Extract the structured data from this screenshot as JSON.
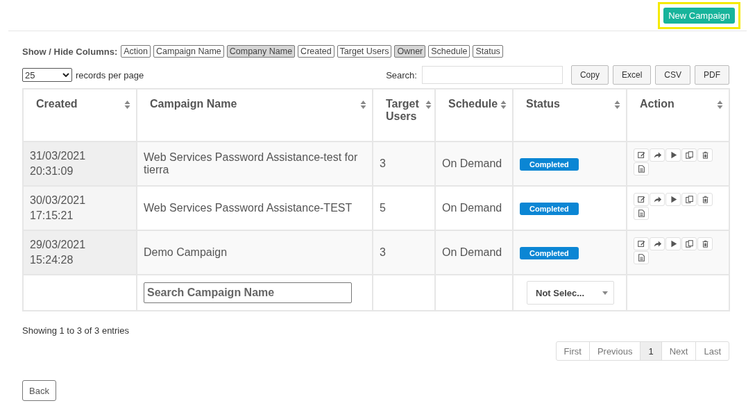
{
  "header": {
    "new_campaign_button": "New Campaign",
    "highlighted": true
  },
  "column_toggles": {
    "label": "Show / Hide Columns:",
    "items": [
      {
        "label": "Action",
        "hidden": false
      },
      {
        "label": "Campaign Name",
        "hidden": false
      },
      {
        "label": "Company Name",
        "hidden": true
      },
      {
        "label": "Created",
        "hidden": false
      },
      {
        "label": "Target Users",
        "hidden": false
      },
      {
        "label": "Owner",
        "hidden": true
      },
      {
        "label": "Schedule",
        "hidden": false
      },
      {
        "label": "Status",
        "hidden": false
      }
    ]
  },
  "page_length": {
    "value": "25",
    "suffix": "records per page"
  },
  "search": {
    "label": "Search:"
  },
  "export_buttons": [
    "Copy",
    "Excel",
    "CSV",
    "PDF"
  ],
  "table": {
    "columns": [
      "Created",
      "Campaign Name",
      "Target Users",
      "Schedule",
      "Status",
      "Action"
    ],
    "rows": [
      {
        "created": "31/03/2021 20:31:09",
        "campaign_name": "Web Services Password Assistance-test for tierra",
        "target_users": "3",
        "schedule": "On Demand",
        "status": "Completed"
      },
      {
        "created": "30/03/2021 17:15:21",
        "campaign_name": "Web Services Password Assistance-TEST",
        "target_users": "5",
        "schedule": "On Demand",
        "status": "Completed"
      },
      {
        "created": "29/03/2021 15:24:28",
        "campaign_name": "Demo Campaign",
        "target_users": "3",
        "schedule": "On Demand",
        "status": "Completed"
      }
    ],
    "filters": {
      "campaign_name_placeholder": "Search Campaign Name",
      "status_select": "Not Selec..."
    }
  },
  "info": "Showing 1 to 3 of 3 entries",
  "pagination": [
    {
      "label": "First",
      "selected": false
    },
    {
      "label": "Previous",
      "selected": false
    },
    {
      "label": "1",
      "selected": true
    },
    {
      "label": "Next",
      "selected": false
    },
    {
      "label": "Last",
      "selected": false
    }
  ],
  "back_button": "Back"
}
